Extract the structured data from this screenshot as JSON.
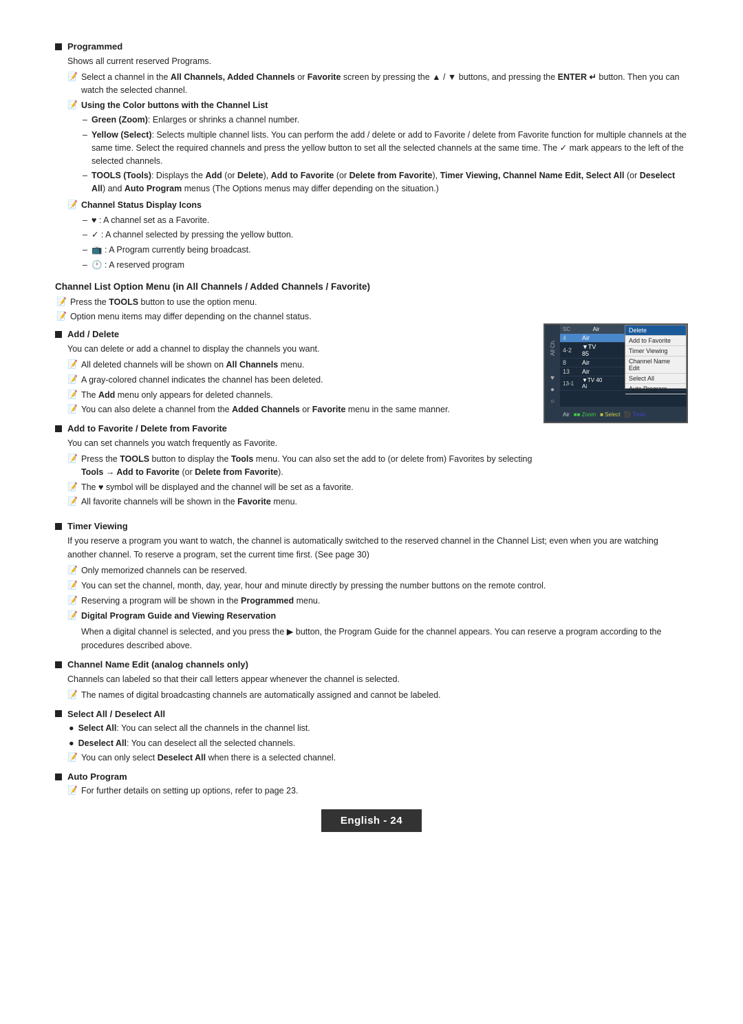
{
  "page": {
    "footer_label": "English - 24"
  },
  "sections": {
    "programmed": {
      "heading": "Programmed",
      "body": "Shows all current reserved Programs.",
      "note1": "Select a channel in the All Channels, Added Channels or Favorite screen by pressing the ▲ / ▼ buttons, and pressing the ENTER  button. Then you can watch the selected channel.",
      "color_buttons_heading": "Using the Color buttons with the Channel List",
      "green": "Green (Zoom): Enlarges or shrinks a channel number.",
      "yellow": "Yellow (Select): Selects multiple channel lists. You can perform the add / delete or add to Favorite / delete from Favorite function for multiple channels at the same time. Select the required channels and press the yellow button to set all the selected channels at the same time. The ✓ mark appears to the left of the selected channels.",
      "tools": "TOOLS (Tools): Displays the Add (or Delete), Add to Favorite (or Delete from Favorite), Timer Viewing, Channel Name Edit, Select All (or Deselect All) and Auto Program menus (The Options menus may differ depending on the situation.)",
      "channel_status_heading": "Channel Status Display Icons",
      "status1": "♥ : A channel set as a Favorite.",
      "status2": "✓ : A channel selected by pressing the yellow button.",
      "status3": " : A Program currently being broadcast.",
      "status4": " : A reserved program"
    },
    "channel_list_option": {
      "heading": "Channel List Option Menu (in All Channels / Added Channels / Favorite)",
      "note1": "Press the TOOLS button to use the option menu.",
      "note2": "Option menu items may differ depending on the channel status."
    },
    "add_delete": {
      "heading": "Add / Delete",
      "body": "You can delete or add a channel to display the channels you want.",
      "note1": "All deleted channels will be shown on All Channels menu.",
      "note2": "A gray-colored channel indicates the channel has been deleted.",
      "note3": "The Add menu only appears for deleted channels.",
      "note4": "You can also delete a channel from the Added Channels or Favorite menu in the same manner."
    },
    "add_favorite": {
      "heading": "Add to Favorite / Delete from Favorite",
      "body": "You can set channels you watch frequently as Favorite.",
      "note1": "Press the TOOLS button to display the Tools menu. You can also set the add to (or delete from) Favorites by selecting Tools → Add to Favorite (or Delete from Favorite).",
      "note2": "The ♥ symbol will be displayed and the channel will be set as a favorite.",
      "note3": "All favorite channels will be shown in the Favorite menu."
    },
    "timer_viewing": {
      "heading": "Timer Viewing",
      "body": "If you reserve a program you want to watch, the channel is automatically switched to the reserved channel in the Channel List; even when you are watching another channel. To reserve a program, set the current time first. (See page 30)",
      "note1": "Only memorized channels can be reserved.",
      "note2": "You can set the channel, month, day, year, hour and minute directly by pressing the number buttons on the remote control.",
      "note3": "Reserving a program will be shown in the Programmed menu.",
      "digital_heading": "Digital Program Guide and Viewing Reservation",
      "digital_body": "When a digital channel is selected, and you press the ▶ button, the Program Guide for the channel appears. You can reserve a program according to the procedures described above."
    },
    "channel_name": {
      "heading": "Channel Name Edit (analog channels only)",
      "body": "Channels can labeled so that their call letters appear whenever the channel is selected.",
      "note1": "The names of digital broadcasting channels are automatically assigned and cannot be labeled."
    },
    "select_all": {
      "heading": "Select All / Deselect All",
      "bullet1": "Select All: You can select all the channels in the channel list.",
      "bullet2": "Deselect All: You can deselect all the selected channels.",
      "note1": "You can only select Deselect All when there is a selected channel."
    },
    "auto_program": {
      "heading": "Auto Program",
      "note1": "For further details on setting up options, refer to page 23."
    }
  },
  "channel_image": {
    "header_left": "All Channels",
    "header_right": "Air",
    "rows": [
      {
        "num": "4",
        "name": "Air",
        "selected": true
      },
      {
        "num": "4-2",
        "name": "▼TV 85",
        "selected": false
      },
      {
        "num": "8",
        "name": "Air",
        "selected": false
      },
      {
        "num": "13",
        "name": "Air",
        "selected": false
      },
      {
        "num": "13-1",
        "name": "▼TV 40 Ai",
        "selected": false
      }
    ],
    "menu_items": [
      "Delete",
      "Add to Favorite",
      "Timer Viewing",
      "Channel Name Edit",
      "Select All",
      "Auto Program"
    ],
    "footer": "Air    ■■ Zoom  ■ Select  ⬛ Tools"
  }
}
